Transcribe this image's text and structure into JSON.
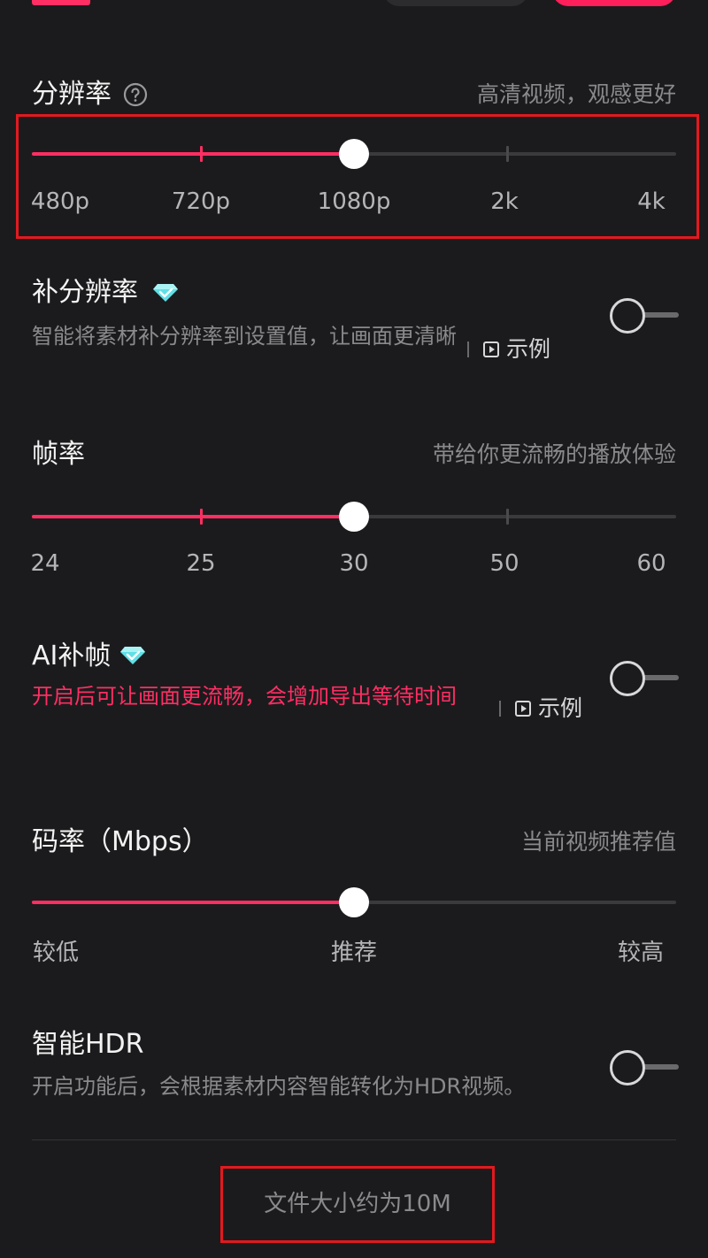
{
  "resolution": {
    "title": "分辨率",
    "hint": "高清视频，观感更好",
    "ticks": [
      "480p",
      "720p",
      "1080p",
      "2k",
      "4k"
    ],
    "selected": "1080p",
    "selected_fraction": 0.5
  },
  "super_resolution": {
    "title": "补分辨率",
    "desc": "智能将素材补分辨率到设置值，让画面更清晰",
    "example_label": "示例",
    "enabled": false
  },
  "frame_rate": {
    "title": "帧率",
    "hint": "带给你更流畅的播放体验",
    "ticks": [
      "24",
      "25",
      "30",
      "50",
      "60"
    ],
    "selected": "30",
    "selected_fraction": 0.5
  },
  "ai_frame": {
    "title": "AI补帧",
    "desc": "开启后可让画面更流畅，会增加导出等待时间",
    "example_label": "示例",
    "enabled": false
  },
  "bitrate": {
    "title": "码率（Mbps）",
    "hint": "当前视频推荐值",
    "ticks": [
      "较低",
      "推荐",
      "较高"
    ],
    "selected": "推荐",
    "selected_fraction": 0.5
  },
  "smart_hdr": {
    "title": "智能HDR",
    "desc": "开启功能后，会根据素材内容智能转化为HDR视频。",
    "enabled": false
  },
  "footer": {
    "file_size": "文件大小约为10M"
  },
  "colors": {
    "accent": "#ff2e63",
    "background": "#1b1b1d",
    "highlight": "#e3191f"
  },
  "icons": {
    "help": "help-circle-icon",
    "vip": "diamond-icon",
    "example": "play-square-icon"
  }
}
